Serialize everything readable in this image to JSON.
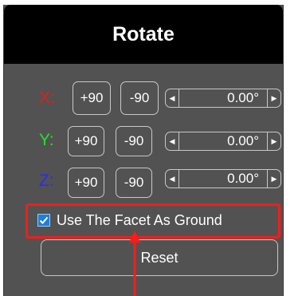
{
  "panel": {
    "title": "Rotate"
  },
  "axes": [
    {
      "label": "X:",
      "color": "#e0201a",
      "plus": "+90",
      "minus": "-90",
      "value": "0.00°"
    },
    {
      "label": "Y:",
      "color": "#28e028",
      "plus": "+90",
      "minus": "-90",
      "value": "0.00°"
    },
    {
      "label": "Z:",
      "color": "#2a2aff",
      "plus": "+90",
      "minus": "-90",
      "value": "0.00°"
    }
  ],
  "facet": {
    "checked": true,
    "label": "Use The Facet As Ground"
  },
  "reset_label": "Reset",
  "colors": {
    "panel_bg": "#525252",
    "title_bg": "#000000",
    "highlight": "#ff1a1a",
    "checkbox": "#1e7fd8"
  },
  "icons": {
    "spin_left": "caret-left-icon",
    "spin_right": "caret-right-icon",
    "check": "checkmark-icon",
    "annotation": "red-arrow-up-icon"
  }
}
